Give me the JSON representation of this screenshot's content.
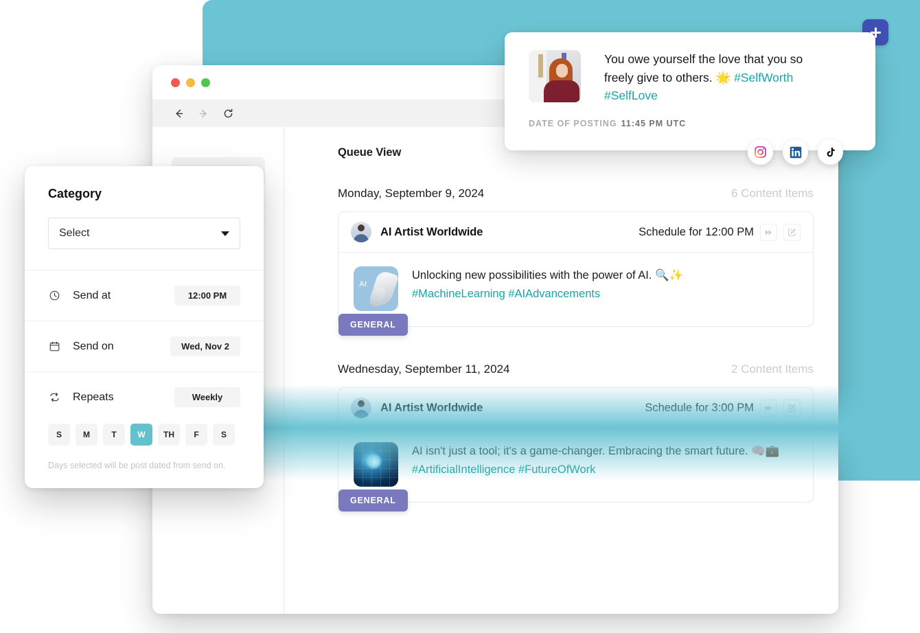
{
  "colors": {
    "teal_backdrop": "#6bc4d4",
    "accent_teal": "#1aa3a8",
    "badge_purple": "#7a79be",
    "plus_blue": "#3f51b5",
    "day_active": "#63c1cd"
  },
  "plus_button": {
    "label": "+",
    "icon": "plus-icon"
  },
  "browser": {
    "traffic_lights": [
      "close",
      "minimize",
      "maximize"
    ],
    "nav": [
      {
        "name": "back",
        "icon": "arrow-left-icon"
      },
      {
        "name": "forward",
        "icon": "arrow-right-icon"
      },
      {
        "name": "reload",
        "icon": "reload-icon"
      }
    ]
  },
  "main": {
    "page_title": "Queue View",
    "days": [
      {
        "date_label": "Monday, September 9, 2024",
        "count_label": "6 Content Items",
        "post": {
          "author": "AI Artist Worldwide",
          "schedule_label": "Schedule for 12:00 PM",
          "text_main": "Unlocking new possibilities with the power of AI. 🔍✨",
          "text_tags": "#MachineLearning #AIAdvancements",
          "badge": "GENERAL",
          "thumb": "robot-hand-image",
          "actions": [
            {
              "name": "skip-button",
              "icon": "fast-forward-icon"
            },
            {
              "name": "edit-button",
              "icon": "edit-square-icon"
            }
          ]
        }
      },
      {
        "date_label": "Wednesday, September 11, 2024",
        "count_label": "2 Content Items",
        "post": {
          "author": "AI Artist Worldwide",
          "schedule_label": "Schedule for 3:00 PM",
          "text_main": "AI isn't just a tool; it's a game-changer. Embracing the smart future. 🧠💼 ",
          "text_tags": "#ArtificialIntelligence #FutureOfWork",
          "badge": "GENERAL",
          "thumb": "circuit-chip-image",
          "actions": [
            {
              "name": "skip-button",
              "icon": "fast-forward-icon"
            },
            {
              "name": "edit-button",
              "icon": "edit-square-icon"
            }
          ]
        }
      }
    ]
  },
  "notification": {
    "thumb": "woman-portrait-image",
    "text_line1": "You owe yourself the love that you so",
    "text_line2a": "freely give to others. 🌟 ",
    "text_line2b": "#SelfWorth",
    "text_line3": "#SelfLove",
    "meta_label": "DATE OF POSTING",
    "meta_value": "11:45 PM UTC",
    "socials": [
      {
        "name": "instagram-icon",
        "label": "Instagram"
      },
      {
        "name": "linkedin-icon",
        "label": "LinkedIn"
      },
      {
        "name": "tiktok-icon",
        "label": "TikTok"
      }
    ]
  },
  "category_card": {
    "title": "Category",
    "select": {
      "value": "Select",
      "placeholder": "Select"
    },
    "send_at": {
      "label": "Send at",
      "value": "12:00 PM",
      "icon": "clock-icon"
    },
    "send_on": {
      "label": "Send on",
      "value": "Wed, Nov 2",
      "icon": "calendar-icon"
    },
    "repeats": {
      "label": "Repeats",
      "value": "Weekly",
      "icon": "repeat-icon"
    },
    "days": [
      {
        "label": "S",
        "active": false
      },
      {
        "label": "M",
        "active": false
      },
      {
        "label": "T",
        "active": false
      },
      {
        "label": "W",
        "active": true
      },
      {
        "label": "TH",
        "active": false
      },
      {
        "label": "F",
        "active": false
      },
      {
        "label": "S",
        "active": false
      }
    ],
    "hint": "Days selected will be post dated from send on."
  }
}
